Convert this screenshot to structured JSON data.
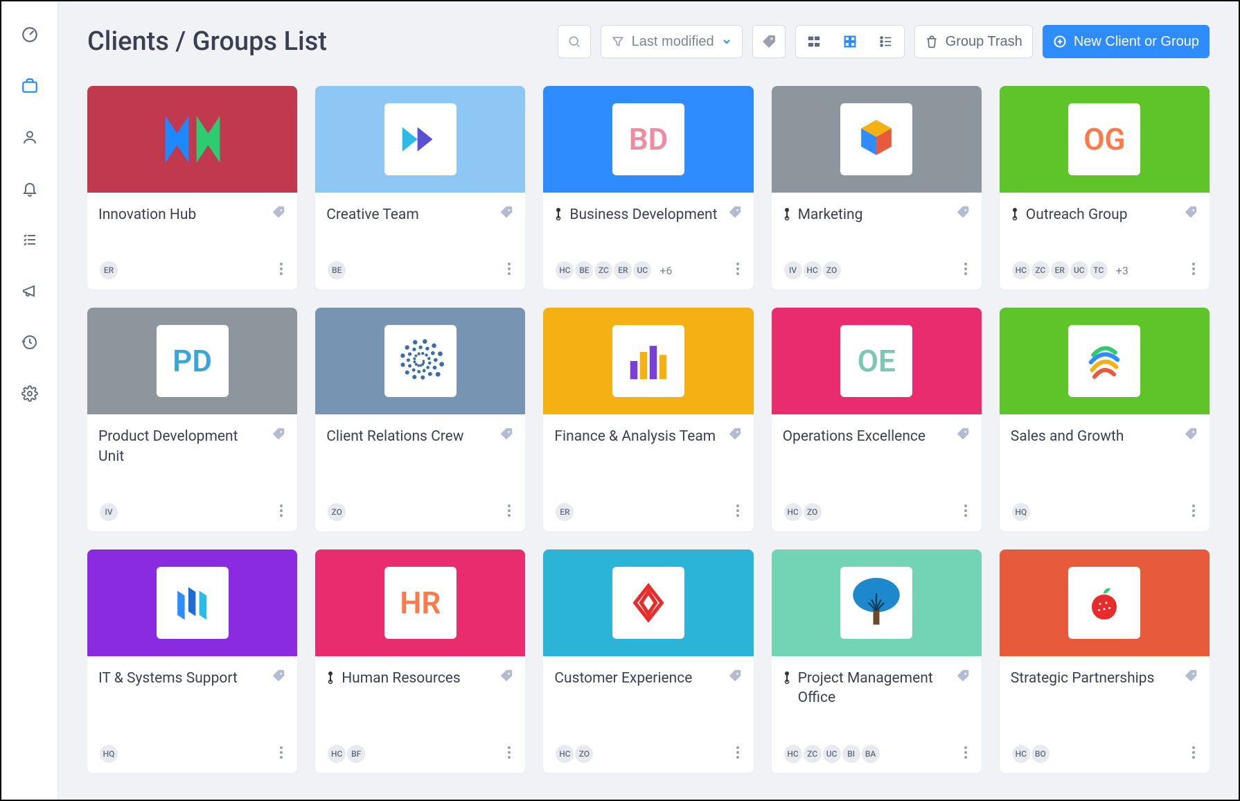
{
  "header": {
    "title": "Clients / Groups List",
    "filter_label": "Last modified",
    "trash_label": "Group Trash",
    "new_label": "New Client or Group"
  },
  "cards": [
    {
      "title": "Innovation Hub",
      "hero_color": "#c0394f",
      "pinned": false,
      "logo_type": "svg-x",
      "avatars": [
        "ER"
      ],
      "more": null
    },
    {
      "title": "Creative Team",
      "hero_color": "#8ec6f4",
      "pinned": false,
      "logo_type": "svg-arrows",
      "avatars": [
        "BE"
      ],
      "more": null
    },
    {
      "title": "Business Development",
      "hero_color": "#2f8cff",
      "pinned": true,
      "logo_type": "text",
      "logo_text": "BD",
      "logo_color": "#f08aa0",
      "avatars": [
        "HC",
        "BE",
        "ZC",
        "ER",
        "UC"
      ],
      "more": "+6"
    },
    {
      "title": "Marketing",
      "hero_color": "#8c969c",
      "pinned": true,
      "logo_type": "svg-cube",
      "avatars": [
        "IV",
        "HC",
        "ZO"
      ],
      "more": null
    },
    {
      "title": "Outreach Group",
      "hero_color": "#5fc42a",
      "pinned": true,
      "logo_type": "text",
      "logo_text": "OG",
      "logo_color": "#ff7a4a",
      "avatars": [
        "HC",
        "ZC",
        "ER",
        "UC",
        "TC"
      ],
      "more": "+3"
    },
    {
      "title": "Product Development Unit",
      "hero_color": "#8c969c",
      "pinned": false,
      "logo_type": "text",
      "logo_text": "PD",
      "logo_color": "#3aa6d6",
      "avatars": [
        "IV"
      ],
      "more": null
    },
    {
      "title": "Client Relations Crew",
      "hero_color": "#7794b3",
      "pinned": false,
      "logo_type": "svg-globe",
      "avatars": [
        "ZO"
      ],
      "more": null
    },
    {
      "title": "Finance & Analysis Team",
      "hero_color": "#f5b014",
      "pinned": false,
      "logo_type": "svg-bars",
      "avatars": [
        "ER"
      ],
      "more": null
    },
    {
      "title": "Operations Excellence",
      "hero_color": "#e82c6e",
      "pinned": false,
      "logo_type": "text",
      "logo_text": "OE",
      "logo_color": "#7bc7b4",
      "avatars": [
        "HC",
        "ZO"
      ],
      "more": null
    },
    {
      "title": "Sales and Growth",
      "hero_color": "#5fc42a",
      "pinned": false,
      "logo_type": "svg-swirl",
      "avatars": [
        "HQ"
      ],
      "more": null
    },
    {
      "title": "IT & Systems Support",
      "hero_color": "#8a2be2",
      "pinned": false,
      "logo_type": "svg-pillars",
      "avatars": [
        "HQ"
      ],
      "more": null
    },
    {
      "title": "Human Resources",
      "hero_color": "#e82c6e",
      "pinned": true,
      "logo_type": "text",
      "logo_text": "HR",
      "logo_color": "#ff7a4a",
      "avatars": [
        "HC",
        "BF"
      ],
      "more": null
    },
    {
      "title": "Customer Experience",
      "hero_color": "#2cb4d6",
      "pinned": false,
      "logo_type": "svg-diamond",
      "avatars": [
        "HC",
        "ZO"
      ],
      "more": null
    },
    {
      "title": "Project Management Office",
      "hero_color": "#73d3b5",
      "pinned": true,
      "logo_type": "svg-tree",
      "avatars": [
        "HC",
        "ZC",
        "UC",
        "BI",
        "BA"
      ],
      "more": null
    },
    {
      "title": "Strategic Partnerships",
      "hero_color": "#e85a3c",
      "pinned": false,
      "logo_type": "svg-berry",
      "avatars": [
        "HC",
        "BO"
      ],
      "more": null
    }
  ]
}
